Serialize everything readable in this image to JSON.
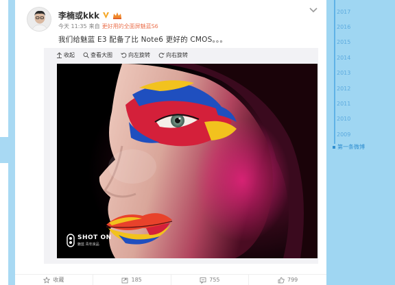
{
  "post": {
    "username": "李楠或kkk",
    "time": "今天 11:35",
    "from_label": "来自",
    "source": "更好用的全面屏魅蓝S6",
    "text": "我们给魅蓝 E3 配备了比 Note6 更好的 CMOS。。。"
  },
  "toolbar": {
    "collapse": "收起",
    "view_large": "查看大图",
    "rotate_left": "向左旋转",
    "rotate_right": "向右旋转"
  },
  "watermark": {
    "title": "SHOT ON",
    "subtitle": "魅蓝 青年良品"
  },
  "actions": {
    "favorite": "收藏",
    "repost": "185",
    "comment": "755",
    "like": "799"
  },
  "timeline": {
    "years": [
      "2017",
      "2016",
      "2015",
      "2014",
      "2013",
      "2012",
      "2011",
      "2010",
      "2009"
    ],
    "first_post": "第一条微博"
  },
  "colors": {
    "accent": "#eb7350",
    "timeline_blue": "#5aa9de",
    "background": "#9fd6f2"
  }
}
